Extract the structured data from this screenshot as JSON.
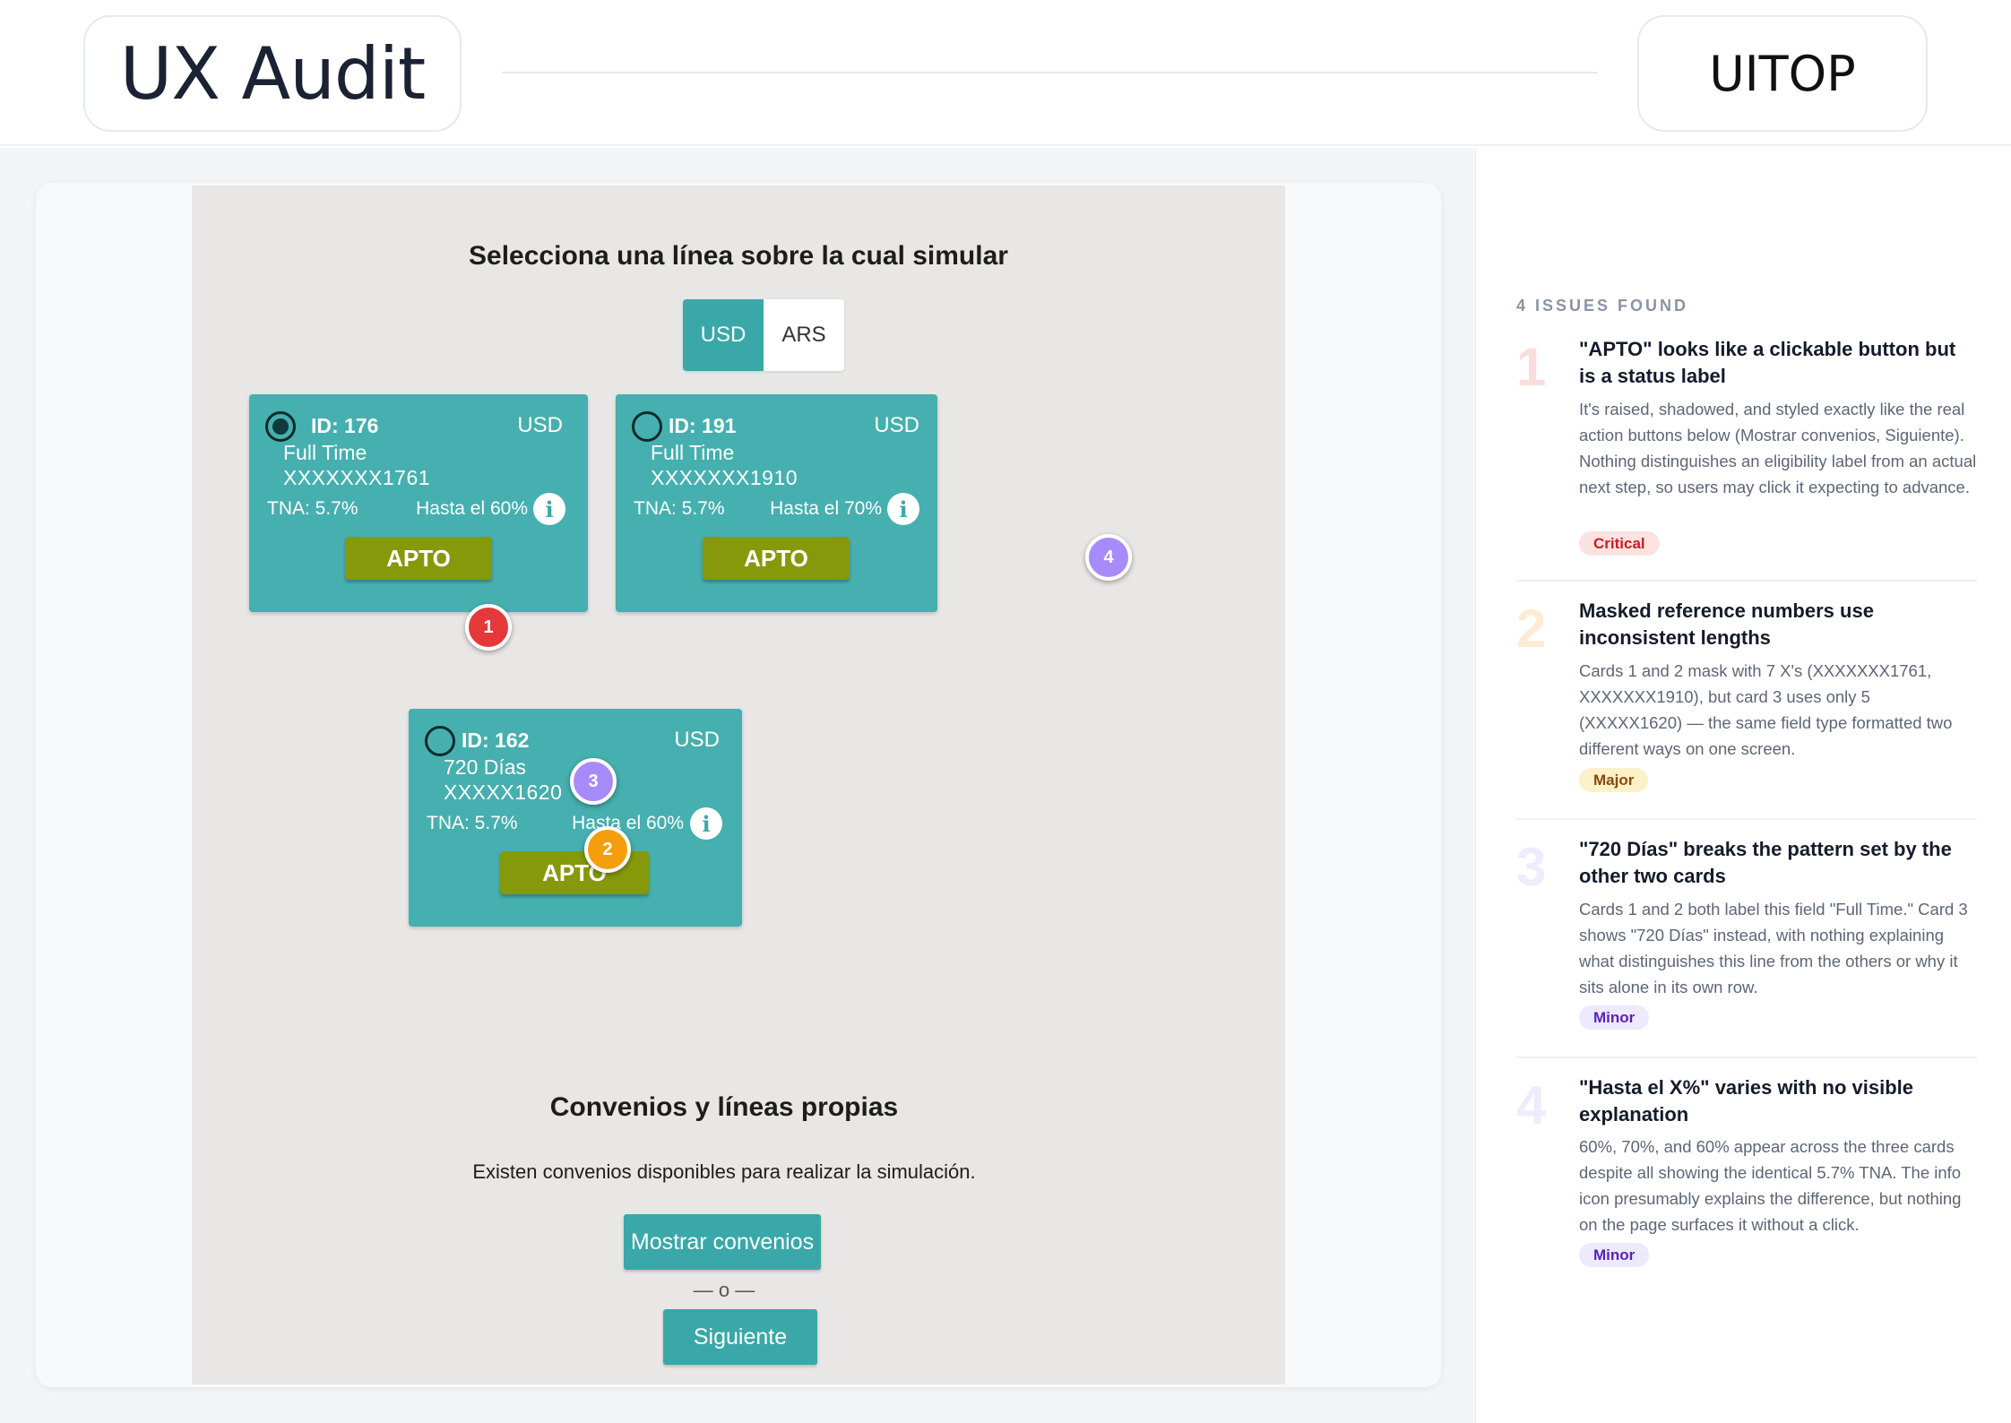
{
  "header": {
    "title": "UX Audit",
    "brand": "UITOP"
  },
  "screenshot": {
    "title": "Selecciona una línea sobre la cual simular",
    "currency_toggle": {
      "active": "USD",
      "inactive": "ARS"
    },
    "cards": [
      {
        "id": "ID: 176",
        "currency": "USD",
        "type": "Full Time",
        "mask": "XXXXXXX1761",
        "tna": "TNA: 5.7%",
        "hasta": "Hasta el 60%",
        "status": "APTO",
        "selected": true
      },
      {
        "id": "ID: 191",
        "currency": "USD",
        "type": "Full Time",
        "mask": "XXXXXXX1910",
        "tna": "TNA: 5.7%",
        "hasta": "Hasta el 70%",
        "status": "APTO",
        "selected": false
      },
      {
        "id": "ID: 162",
        "currency": "USD",
        "type": "720 Días",
        "mask": "XXXXX1620",
        "tna": "TNA: 5.7%",
        "hasta": "Hasta el 60%",
        "status": "APTO",
        "selected": false
      }
    ],
    "convenios_title": "Convenios y líneas propias",
    "convenios_text": "Existen convenios disponibles para realizar la simulación.",
    "mostrar_button": "Mostrar convenios",
    "separator": "— o —",
    "siguiente_button": "Siguiente",
    "info_glyph": "i"
  },
  "markers": [
    "1",
    "2",
    "3",
    "4"
  ],
  "marker_colors": {
    "critical": "#e5383b",
    "major": "#f59e0b",
    "minor": "#a78bfa"
  },
  "issues_panel": {
    "count_label": "4 ISSUES FOUND",
    "issues": [
      {
        "number": "1",
        "title": "\"APTO\" looks like a clickable button but is a status label",
        "description": "It's raised, shadowed, and styled exactly like the real action buttons below (Mostrar convenios, Siguiente). Nothing distinguishes an eligibility label from an actual next step, so users may click it expecting to advance.",
        "severity": "Critical"
      },
      {
        "number": "2",
        "title": "Masked reference numbers use inconsistent lengths",
        "description": "Cards 1 and 2 mask with 7 X's (XXXXXXX1761, XXXXXXX1910), but card 3 uses only 5 (XXXXX1620) — the same field type formatted two different ways on one screen.",
        "severity": "Major"
      },
      {
        "number": "3",
        "title": "\"720 Días\" breaks the pattern set by the other two cards",
        "description": "Cards 1 and 2 both label this field \"Full Time.\" Card 3 shows \"720 Días\" instead, with nothing explaining what distinguishes this line from the others or why it sits alone in its own row.",
        "severity": "Minor"
      },
      {
        "number": "4",
        "title": "\"Hasta el X%\" varies with no visible explanation",
        "description": "60%, 70%, and 60% appear across the three cards despite all showing the identical 5.7% TNA. The info icon presumably explains the difference, but nothing on the page surfaces it without a click.",
        "severity": "Minor"
      }
    ]
  }
}
